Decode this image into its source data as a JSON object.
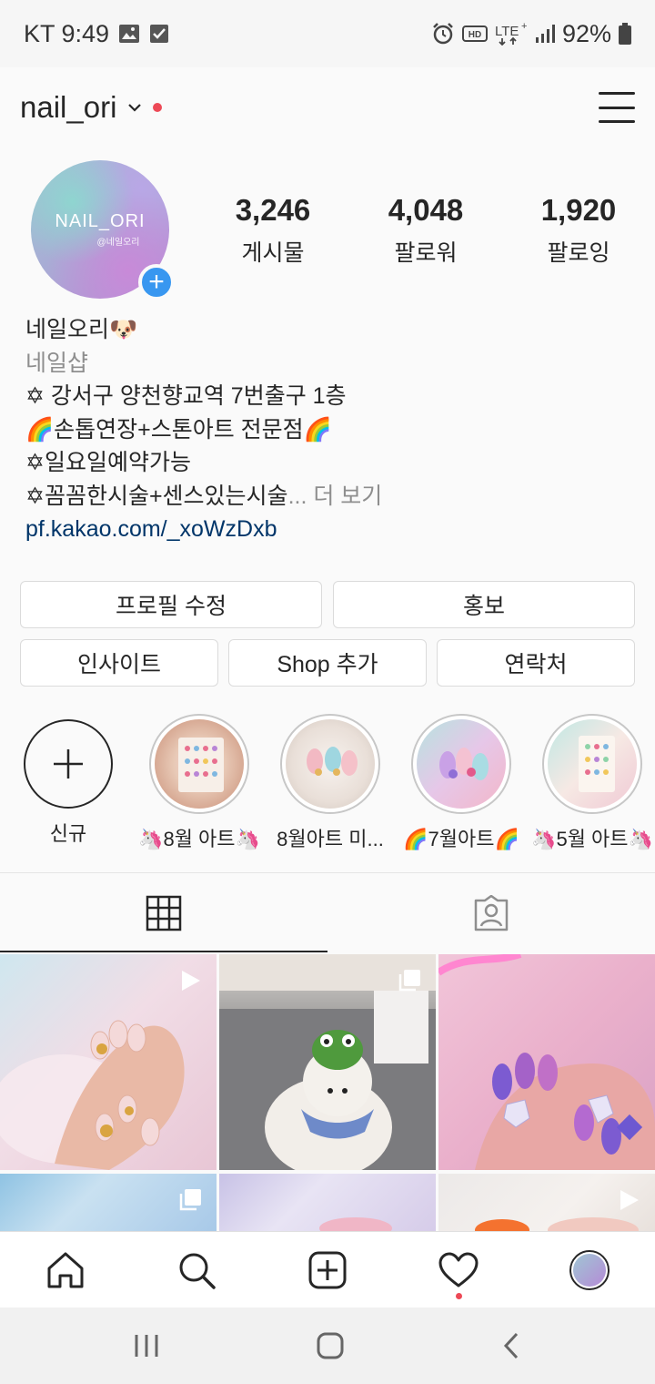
{
  "status_bar": {
    "carrier_time": "KT 9:49",
    "battery": "92%"
  },
  "header": {
    "username": "nail_ori"
  },
  "profile": {
    "avatar_text": "NAIL_ORI",
    "avatar_subtext": "@네일오리",
    "stats": [
      {
        "value": "3,246",
        "label": "게시물"
      },
      {
        "value": "4,048",
        "label": "팔로워"
      },
      {
        "value": "1,920",
        "label": "팔로잉"
      }
    ],
    "bio": {
      "name": "네일오리🐶",
      "category": "네일샵",
      "lines": [
        "✡ 강서구 양천향교역 7번출구 1층",
        "🌈손톱연장+스톤아트 전문점🌈",
        "✡일요일예약가능",
        "✡꼼꼼한시술+센스있는시술"
      ],
      "more": "... 더 보기",
      "link": "pf.kakao.com/_xoWzDxb"
    }
  },
  "buttons": {
    "edit_profile": "프로필 수정",
    "promote": "홍보",
    "insights": "인사이트",
    "add_shop": "Shop 추가",
    "contact": "연락처"
  },
  "highlights": [
    {
      "label": "신규"
    },
    {
      "label": "🦄8월 아트🦄"
    },
    {
      "label": "8월아트 미..."
    },
    {
      "label": "🌈7월아트🌈"
    },
    {
      "label": "🦄5월 아트🦄"
    }
  ],
  "colors": {
    "accent_blue": "#3897f0",
    "notification_red": "#ed4956",
    "link": "#003569"
  }
}
